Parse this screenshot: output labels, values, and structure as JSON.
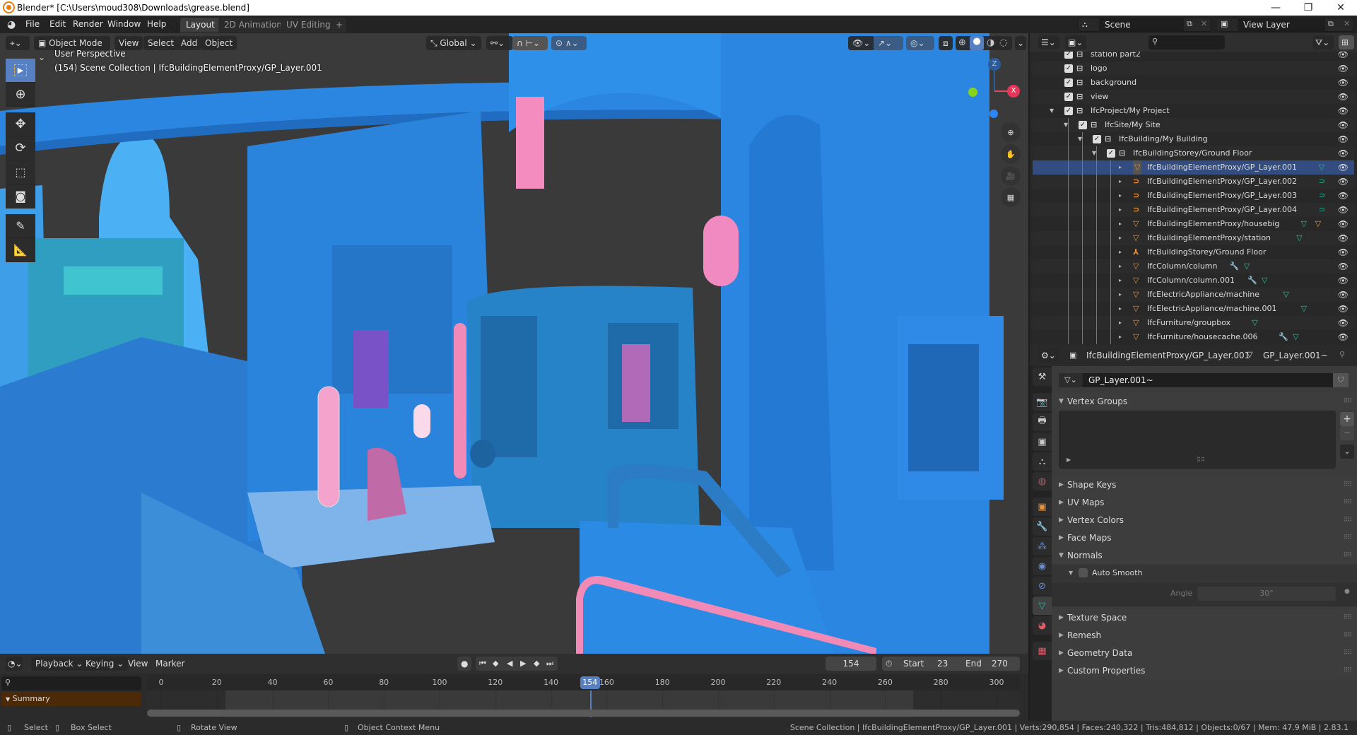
{
  "window": {
    "title": "Blender* [C:\\Users\\moud308\\Downloads\\grease.blend]",
    "controls": {
      "minimize": "—",
      "maximize": "❐",
      "close": "✕"
    }
  },
  "topbar": {
    "menus": [
      "File",
      "Edit",
      "Render",
      "Window",
      "Help"
    ],
    "workspaces": [
      "Layout",
      "2D Animation",
      "UV Editing"
    ],
    "active_workspace": "Layout",
    "add_workspace": "+",
    "scene": "Scene",
    "view_layer": "View Layer"
  },
  "viewport": {
    "mode": "Object Mode",
    "menus": [
      "View",
      "Select",
      "Add",
      "Object"
    ],
    "transform_orientation": "Global",
    "overlay_line1": "User Perspective",
    "overlay_line2": "(154) Scene Collection | IfcBuildingElementProxy/GP_Layer.001",
    "gizmo_axes": {
      "x": "X",
      "z": "Z"
    },
    "shading_active": "solid",
    "colors": {
      "accent": "#5680c2",
      "scene_blue": "#2a7fd4",
      "pink": "#f07eb4"
    }
  },
  "timeline": {
    "menus": [
      "Playback",
      "Keying",
      "View",
      "Marker"
    ],
    "current_frame": "154",
    "start_label": "Start",
    "start": "23",
    "end_label": "End",
    "end": "270",
    "ticks": [
      "0",
      "20",
      "40",
      "60",
      "80",
      "100",
      "120",
      "140",
      "160",
      "180",
      "200",
      "220",
      "240",
      "260",
      "280",
      "300"
    ],
    "summary_label": "Summary",
    "playhead_label": "154"
  },
  "status": {
    "hints": [
      {
        "icon": "mouse-left-icon",
        "label": "Select"
      },
      {
        "icon": "mouse-drag-icon",
        "label": "Box Select"
      },
      {
        "icon": "mouse-middle-icon",
        "label": "Rotate View"
      },
      {
        "icon": "mouse-right-icon",
        "label": "Object Context Menu"
      }
    ],
    "info": "Scene Collection | IfcBuildingElementProxy/GP_Layer.001 | Verts:290,854 | Faces:240,322 | Tris:484,812 | Objects:0/67 | Mem: 47.9 MiB | 2.83.1"
  },
  "outliner": {
    "rows": [
      {
        "label": "station part2",
        "depth": 0,
        "type": "collection",
        "checked": true
      },
      {
        "label": "logo",
        "depth": 0,
        "type": "collection",
        "checked": true
      },
      {
        "label": "background",
        "depth": 0,
        "type": "collection",
        "checked": true
      },
      {
        "label": "view",
        "depth": 0,
        "type": "collection",
        "checked": true
      },
      {
        "label": "IfcProject/My Project",
        "depth": 0,
        "type": "collection",
        "checked": true,
        "expanded": true
      },
      {
        "label": "IfcSite/My Site",
        "depth": 1,
        "type": "collection",
        "checked": true,
        "expanded": true
      },
      {
        "label": "IfcBuilding/My Building",
        "depth": 2,
        "type": "collection",
        "checked": true,
        "expanded": true
      },
      {
        "label": "IfcBuildingStorey/Ground Floor",
        "depth": 3,
        "type": "collection",
        "checked": true,
        "expanded": true
      },
      {
        "label": "IfcBuildingElementProxy/GP_Layer.001",
        "depth": 4,
        "type": "mesh",
        "extras": [
          "mesh-data"
        ],
        "selected": true
      },
      {
        "label": "IfcBuildingElementProxy/GP_Layer.002",
        "depth": 4,
        "type": "curve",
        "extras": [
          "curve-data"
        ]
      },
      {
        "label": "IfcBuildingElementProxy/GP_Layer.003",
        "depth": 4,
        "type": "curve",
        "extras": [
          "curve-data"
        ]
      },
      {
        "label": "IfcBuildingElementProxy/GP_Layer.004",
        "depth": 4,
        "type": "curve",
        "extras": [
          "curve-data"
        ]
      },
      {
        "label": "IfcBuildingElementProxy/housebig",
        "depth": 4,
        "type": "mesh",
        "extras": [
          "mesh-data",
          "mesh-object"
        ]
      },
      {
        "label": "IfcBuildingElementProxy/station",
        "depth": 4,
        "type": "mesh",
        "extras": [
          "mesh-data"
        ]
      },
      {
        "label": "IfcBuildingStorey/Ground Floor",
        "depth": 4,
        "type": "empty",
        "extras": []
      },
      {
        "label": "IfcColumn/column",
        "depth": 4,
        "type": "mesh",
        "extras": [
          "modifier",
          "mesh-data"
        ]
      },
      {
        "label": "IfcColumn/column.001",
        "depth": 4,
        "type": "mesh",
        "extras": [
          "modifier",
          "mesh-data"
        ]
      },
      {
        "label": "IfcElectricAppliance/machine",
        "depth": 4,
        "type": "mesh",
        "extras": [
          "mesh-data"
        ]
      },
      {
        "label": "IfcElectricAppliance/machine.001",
        "depth": 4,
        "type": "mesh",
        "extras": [
          "mesh-data"
        ]
      },
      {
        "label": "IfcFurniture/groupbox",
        "depth": 4,
        "type": "mesh",
        "extras": [
          "mesh-data"
        ]
      },
      {
        "label": "IfcFurniture/housecache.006",
        "depth": 4,
        "type": "mesh",
        "extras": [
          "modifier",
          "mesh-data"
        ]
      }
    ]
  },
  "properties": {
    "breadcrumb_object": "IfcBuildingElementProxy/GP_Layer.001",
    "breadcrumb_data": "GP_Layer.001~",
    "data_name": "GP_Layer.001~",
    "tabs": [
      "tool",
      "render",
      "output",
      "view-layer",
      "scene",
      "world",
      "object",
      "modifiers",
      "particles",
      "physics",
      "constraints",
      "data",
      "material",
      "texture"
    ],
    "active_tab": "data",
    "panels": [
      {
        "label": "Vertex Groups",
        "open": true
      },
      {
        "label": "Shape Keys",
        "open": false
      },
      {
        "label": "UV Maps",
        "open": false
      },
      {
        "label": "Vertex Colors",
        "open": false
      },
      {
        "label": "Face Maps",
        "open": false
      },
      {
        "label": "Normals",
        "open": true
      },
      {
        "label": "Texture Space",
        "open": false
      },
      {
        "label": "Remesh",
        "open": false
      },
      {
        "label": "Geometry Data",
        "open": false
      },
      {
        "label": "Custom Properties",
        "open": false
      }
    ],
    "auto_smooth_label": "Auto Smooth",
    "auto_smooth": false,
    "angle_label": "Angle",
    "angle_value": "30°"
  }
}
